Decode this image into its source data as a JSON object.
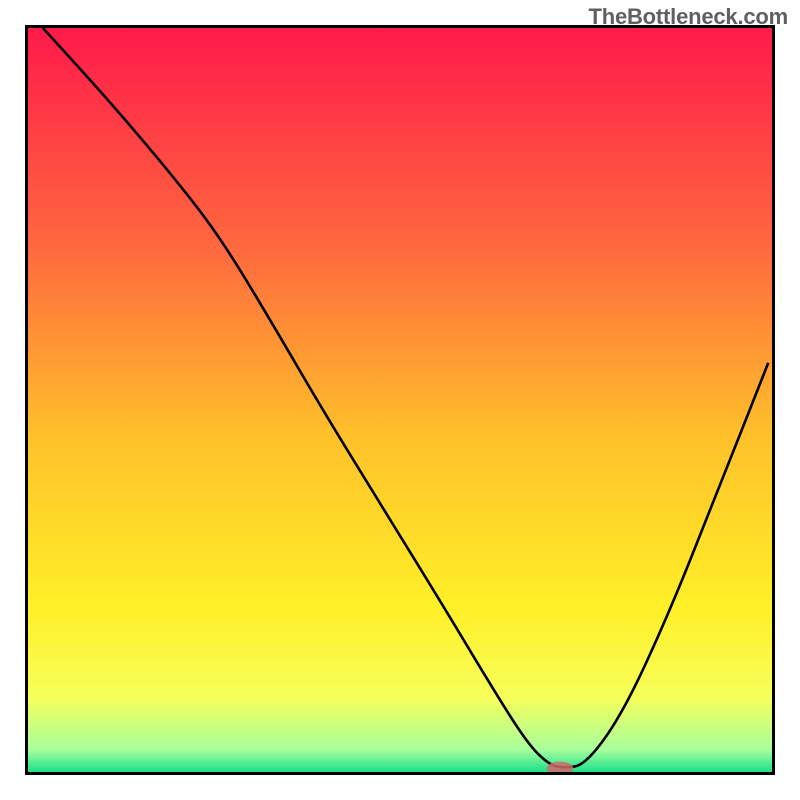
{
  "watermark": "TheBottleneck.com",
  "chart_data": {
    "type": "line",
    "title": "",
    "xlabel": "",
    "ylabel": "",
    "xlim": [
      0,
      100
    ],
    "ylim": [
      0,
      100
    ],
    "grid": false,
    "legend": false,
    "background_gradient": [
      {
        "pos": 0.0,
        "color": "#ff1a4a"
      },
      {
        "pos": 0.3,
        "color": "#ff6a3e"
      },
      {
        "pos": 0.55,
        "color": "#ffc12a"
      },
      {
        "pos": 0.78,
        "color": "#fff028"
      },
      {
        "pos": 0.9,
        "color": "#f6ff5a"
      },
      {
        "pos": 0.97,
        "color": "#a8ff9c"
      },
      {
        "pos": 1.0,
        "color": "#18e08c"
      }
    ],
    "series": [
      {
        "name": "curve",
        "x": [
          2,
          12,
          22,
          27,
          33,
          40,
          48,
          56,
          62,
          67,
          70,
          72,
          75,
          80,
          86,
          92,
          99.5
        ],
        "y": [
          100,
          89,
          77,
          70,
          60,
          48,
          35,
          22,
          12,
          4,
          1,
          0.5,
          1,
          8,
          21,
          36,
          55
        ],
        "stroke": "#000000",
        "stroke_width": 2.6
      }
    ],
    "marker": {
      "name": "optimal-point",
      "x": 71.5,
      "y": 0.5,
      "rx": 1.8,
      "ry": 0.9,
      "fill": "#d06868",
      "opacity": 0.85
    }
  }
}
